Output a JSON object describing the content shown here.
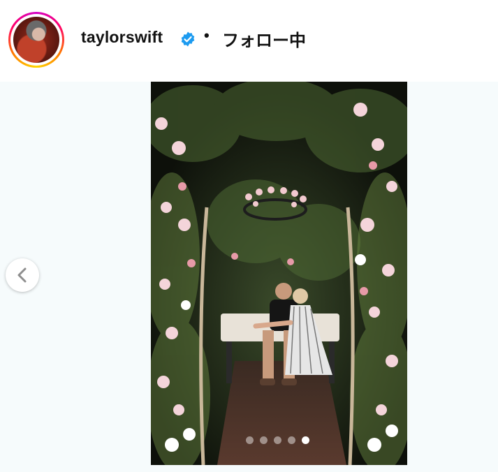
{
  "post_header": {
    "username": "taylorswift",
    "verified": true,
    "separator": "•",
    "follow_status": "フォロー中"
  },
  "carousel": {
    "total_slides": 5,
    "active_slide": 5,
    "prev_icon": "chevron-left-icon"
  },
  "colors": {
    "verified_badge": "#1d9bf0",
    "text": "#111111",
    "media_background": "#f6fbfc"
  }
}
